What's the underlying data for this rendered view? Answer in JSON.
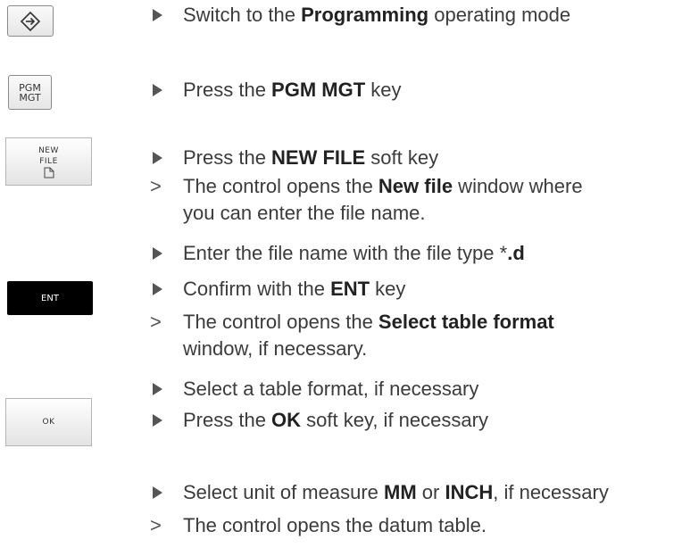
{
  "keys": {
    "mode_key_icon": "programming-mode-icon",
    "pgm_line1": "PGM",
    "pgm_line2": "MGT",
    "newfile_line1": "NEW",
    "newfile_line2": "FILE",
    "newfile_icon": "file-icon",
    "ent_label": "ENT",
    "ok_label": "OK"
  },
  "steps": [
    {
      "marker": "action",
      "text_before": "Switch to the ",
      "bold": "Programming",
      "text_after": " operating mode"
    },
    {
      "marker": "action",
      "text_before": "Press the ",
      "bold": "PGM MGT",
      "text_after": " key"
    },
    {
      "marker": "action",
      "text_before": "Press the ",
      "bold": "NEW FILE",
      "text_after": " soft key"
    },
    {
      "marker": "result",
      "text_before": "The control opens the ",
      "bold": "New file",
      "text_after": " window where",
      "line2": "you can enter the file name."
    },
    {
      "marker": "action",
      "text_before": "Enter the file name with the file type *",
      "bold": ".d",
      "text_after": ""
    },
    {
      "marker": "action",
      "text_before": "Confirm with the ",
      "bold": "ENT",
      "text_after": " key"
    },
    {
      "marker": "result",
      "text_before": "The control opens the ",
      "bold": "Select table format",
      "text_after": "",
      "line2": "window, if necessary."
    },
    {
      "marker": "action",
      "text_before": "Select a table format, if necessary",
      "bold": "",
      "text_after": ""
    },
    {
      "marker": "action",
      "text_before": "Press the ",
      "bold": "OK",
      "text_after": " soft key, if necessary"
    },
    {
      "marker": "action",
      "text_before": "Select unit of measure ",
      "bold": "MM",
      "text_after": " or ",
      "bold2": "INCH",
      "text_after2": ", if necessary"
    },
    {
      "marker": "result",
      "text_before": "The control opens the datum table.",
      "bold": "",
      "text_after": ""
    }
  ],
  "markers": {
    "result_glyph": ">"
  }
}
